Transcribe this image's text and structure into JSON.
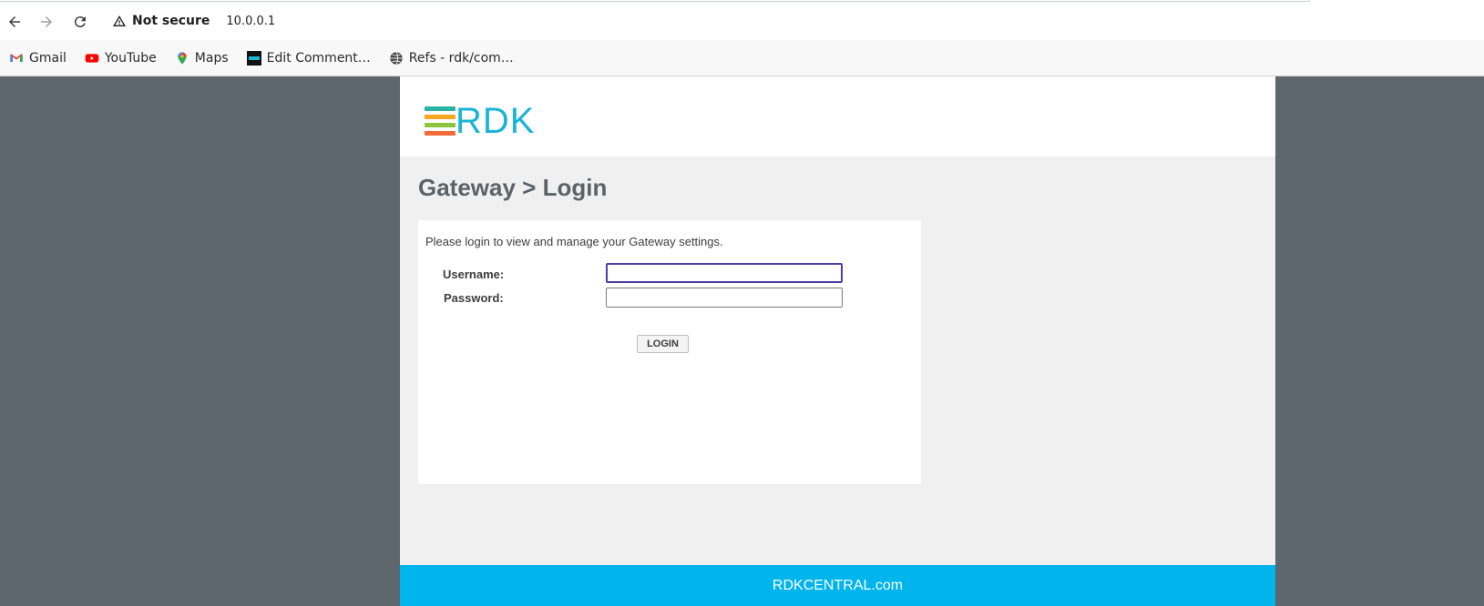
{
  "browser": {
    "security_label": "Not secure",
    "url": "10.0.0.1",
    "nav": {
      "back_icon": "back-arrow-icon",
      "forward_icon": "forward-arrow-icon",
      "reload_icon": "reload-icon"
    },
    "bookmarks": [
      {
        "label": "Gmail",
        "icon": "gmail-icon"
      },
      {
        "label": "YouTube",
        "icon": "youtube-icon"
      },
      {
        "label": "Maps",
        "icon": "maps-pin-icon"
      },
      {
        "label": "Edit Comment…",
        "icon": "site-favicon-icon"
      },
      {
        "label": "Refs - rdk/com…",
        "icon": "globe-icon"
      }
    ]
  },
  "page": {
    "logo_text": "RDK",
    "title": "Gateway > Login",
    "intro": "Please login to view and manage your Gateway settings.",
    "username_label": "Username:",
    "password_label": "Password:",
    "username_value": "",
    "password_value": "",
    "login_button": "LOGIN",
    "footer_link": "RDKCENTRAL.com"
  },
  "colors": {
    "page_bg": "#5e676d",
    "content_bg": "#f0f0f0",
    "footer": "#00b4ec",
    "logo_blue": "#1ab5d6",
    "title": "#5b6369",
    "logo_bars": [
      "#2bb3a5",
      "#f5a623",
      "#8cc63f",
      "#f26b3a"
    ]
  }
}
